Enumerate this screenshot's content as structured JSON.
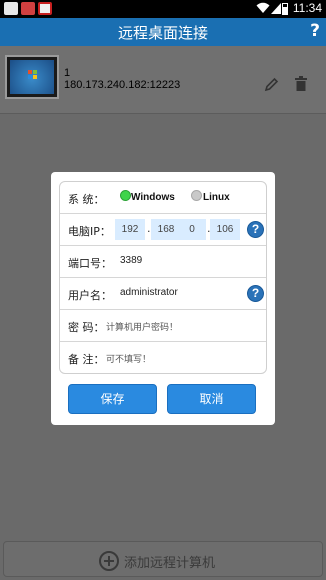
{
  "status_bar": {
    "time": "11:34"
  },
  "header": {
    "title": "远程桌面连接",
    "help": "?"
  },
  "computer_list": [
    {
      "name": "1",
      "address": "180.173.240.182:12223"
    }
  ],
  "dialog": {
    "system_label": "系    统：",
    "system_options": [
      "Windows",
      "Linux"
    ],
    "system_selected": "Windows",
    "ip_label": "电脑IP：",
    "ip_parts": [
      "192",
      "168",
      "0",
      "106"
    ],
    "ip_separator": ".",
    "port_label": "端口号：",
    "port_value": "3389",
    "user_label": "用户名：",
    "user_value": "administrator",
    "password_label": "密  码：",
    "password_placeholder": "计算机用户密码！",
    "note_label": "备  注：",
    "note_placeholder": "可不填写！",
    "help_glyph": "?",
    "save_label": "保存",
    "cancel_label": "取消"
  },
  "add_button": {
    "label": "添加远程计算机"
  },
  "colors": {
    "titlebar": "#1a6fb2",
    "button": "#2a8ae0",
    "radio_on": "#3ed44a",
    "ip_field": "#d9ecff",
    "overlay": "#6a6a6a"
  },
  "icons": {
    "wifi": "wifi-icon",
    "edit": "pencil-icon",
    "delete": "trash-icon",
    "help": "question-icon",
    "add": "plus-circle-icon"
  }
}
